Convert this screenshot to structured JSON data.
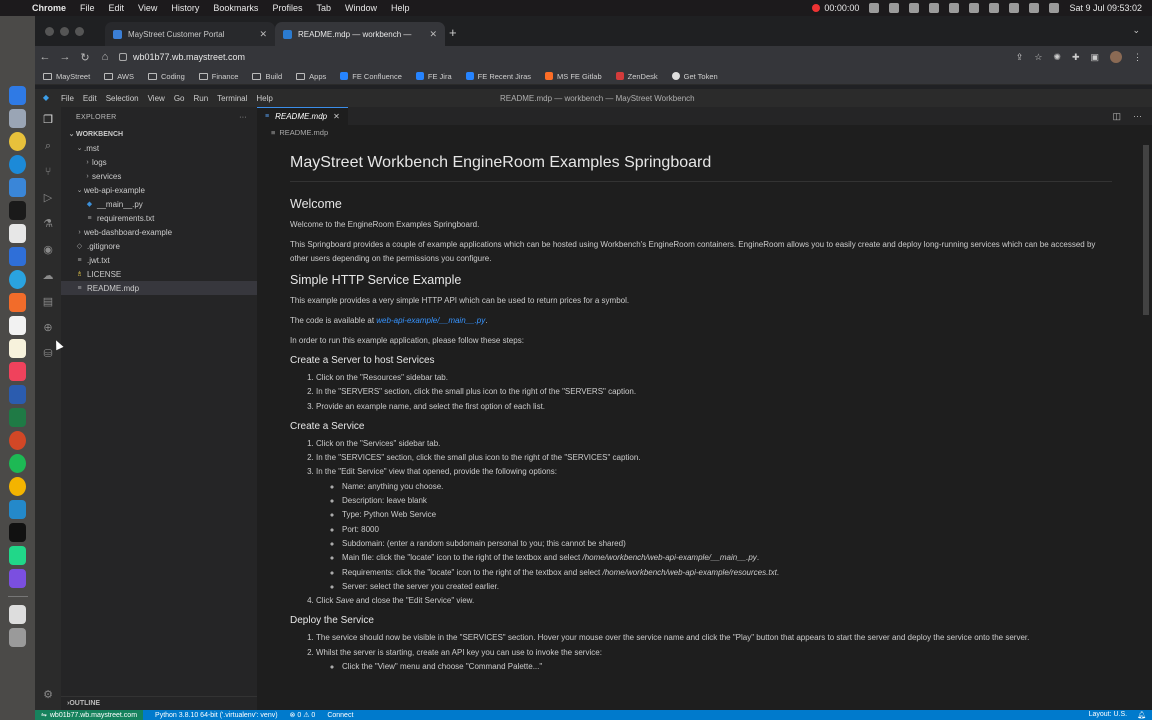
{
  "macos": {
    "app": "Chrome",
    "menu": [
      "File",
      "Edit",
      "View",
      "History",
      "Bookmarks",
      "Profiles",
      "Tab",
      "Window",
      "Help"
    ],
    "recording_time": "00:00:00",
    "clock": "Sat 9 Jul  09:53:02"
  },
  "browser": {
    "tabs": [
      {
        "title": "MayStreet Customer Portal",
        "active": false
      },
      {
        "title": "README.mdp — workbench —",
        "active": true
      }
    ],
    "url": "wb01b77.wb.maystreet.com",
    "bookmarks": [
      {
        "label": "MayStreet",
        "type": "folder"
      },
      {
        "label": "AWS",
        "type": "folder"
      },
      {
        "label": "Coding",
        "type": "folder"
      },
      {
        "label": "Finance",
        "type": "folder"
      },
      {
        "label": "Build",
        "type": "folder"
      },
      {
        "label": "Apps",
        "type": "folder"
      },
      {
        "label": "FE Confluence",
        "type": "link",
        "color": "#2684ff"
      },
      {
        "label": "FE Jira",
        "type": "link",
        "color": "#2684ff"
      },
      {
        "label": "FE Recent Jiras",
        "type": "link",
        "color": "#2684ff"
      },
      {
        "label": "MS FE Gitlab",
        "type": "link",
        "color": "#fc6d26"
      },
      {
        "label": "ZenDesk",
        "type": "link",
        "color": "#d33b3b"
      },
      {
        "label": "Get Token",
        "type": "link",
        "color": "#dddddd"
      }
    ]
  },
  "vscode": {
    "menu": [
      "File",
      "Edit",
      "Selection",
      "View",
      "Go",
      "Run",
      "Terminal",
      "Help"
    ],
    "window_title": "README.mdp — workbench — MayStreet Workbench",
    "explorer": {
      "header": "EXPLORER",
      "root": "WORKBENCH",
      "items": [
        {
          "label": ".mst",
          "kind": "folder-open",
          "depth": 1
        },
        {
          "label": "logs",
          "kind": "folder",
          "depth": 2
        },
        {
          "label": "services",
          "kind": "folder",
          "depth": 2
        },
        {
          "label": "web-api-example",
          "kind": "folder-open",
          "depth": 1
        },
        {
          "label": "__main__.py",
          "kind": "python",
          "depth": 2
        },
        {
          "label": "requirements.txt",
          "kind": "text",
          "depth": 2
        },
        {
          "label": "web-dashboard-example",
          "kind": "folder",
          "depth": 1
        },
        {
          "label": ".gitignore",
          "kind": "file",
          "depth": 1
        },
        {
          "label": ".jwt.txt",
          "kind": "text",
          "depth": 1
        },
        {
          "label": "LICENSE",
          "kind": "license",
          "depth": 1
        },
        {
          "label": "README.mdp",
          "kind": "text",
          "depth": 1,
          "selected": true
        }
      ],
      "outline": "OUTLINE"
    },
    "editor_tab": "README.mdp",
    "breadcrumb": "README.mdp",
    "doc": {
      "h1": "MayStreet Workbench EngineRoom Examples Springboard",
      "welcome_h": "Welcome",
      "welcome_p1": "Welcome to the EngineRoom Examples Springboard.",
      "welcome_p2": "This Springboard provides a couple of example applications which can be hosted using Workbench's EngineRoom containers. EngineRoom allows you to easily create and deploy long-running services which can be accessed by other users depending on the permissions you configure.",
      "http_h": "Simple HTTP Service Example",
      "http_p1": "This example provides a very simple HTTP API which can be used to return prices for a symbol.",
      "http_code_prefix": "The code is available at ",
      "http_code_link": "web-api-example/__main__.py",
      "http_code_suffix": ".",
      "http_p3": "In order to run this example application, please follow these steps:",
      "server_h": "Create a Server to host Services",
      "server_steps": [
        "Click on the \"Resources\" sidebar tab.",
        "In the \"SERVERS\" section, click the small plus icon to the right of the \"SERVERS\" caption.",
        "Provide an example name, and select the first option of each list."
      ],
      "service_h": "Create a Service",
      "service_steps": [
        "Click on the \"Services\" sidebar tab.",
        "In the \"SERVICES\" section, click the small plus icon to the right of the \"SERVICES\" caption.",
        "In the \"Edit Service\" view that opened, provide the following options:"
      ],
      "service_options": [
        "Name: anything you choose.",
        "Description: leave blank",
        "Type: Python Web Service",
        "Port: 8000",
        "Subdomain: (enter a random subdomain personal to you; this cannot be shared)"
      ],
      "main_file_prefix": "Main file: click the \"locate\" icon to the right of the textbox and select ",
      "main_file_path": "/home/workbench/web-api-example/__main__.py",
      "req_prefix": "Requirements: click the \"locate\" icon to the right of the textbox and select ",
      "req_path": "/home/workbench/web-api-example/resources.txt",
      "server_option": "Server: select the server you created earlier.",
      "step4_prefix": "Click ",
      "step4_em": "Save",
      "step4_suffix": " and close the \"Edit Service\" view.",
      "deploy_h": "Deploy the Service",
      "deploy_steps": [
        "The service should now be visible in the \"SERVICES\" section. Hover your mouse over the service name and click the \"Play\" button that appears to start the server and deploy the service onto the server.",
        "Whilst the server is starting, create an API key you can use to invoke the service:"
      ],
      "deploy_sub": [
        "Click the \"View\" menu and choose \"Command Palette...\""
      ]
    },
    "status": {
      "remote": "wb01b77.wb.maystreet.com",
      "python": "Python 3.8.10 64-bit ('.virtualenv': venv)",
      "problems": "⊗ 0 ⚠ 0",
      "connect": "Connect",
      "layout": "Layout: U.S."
    }
  }
}
